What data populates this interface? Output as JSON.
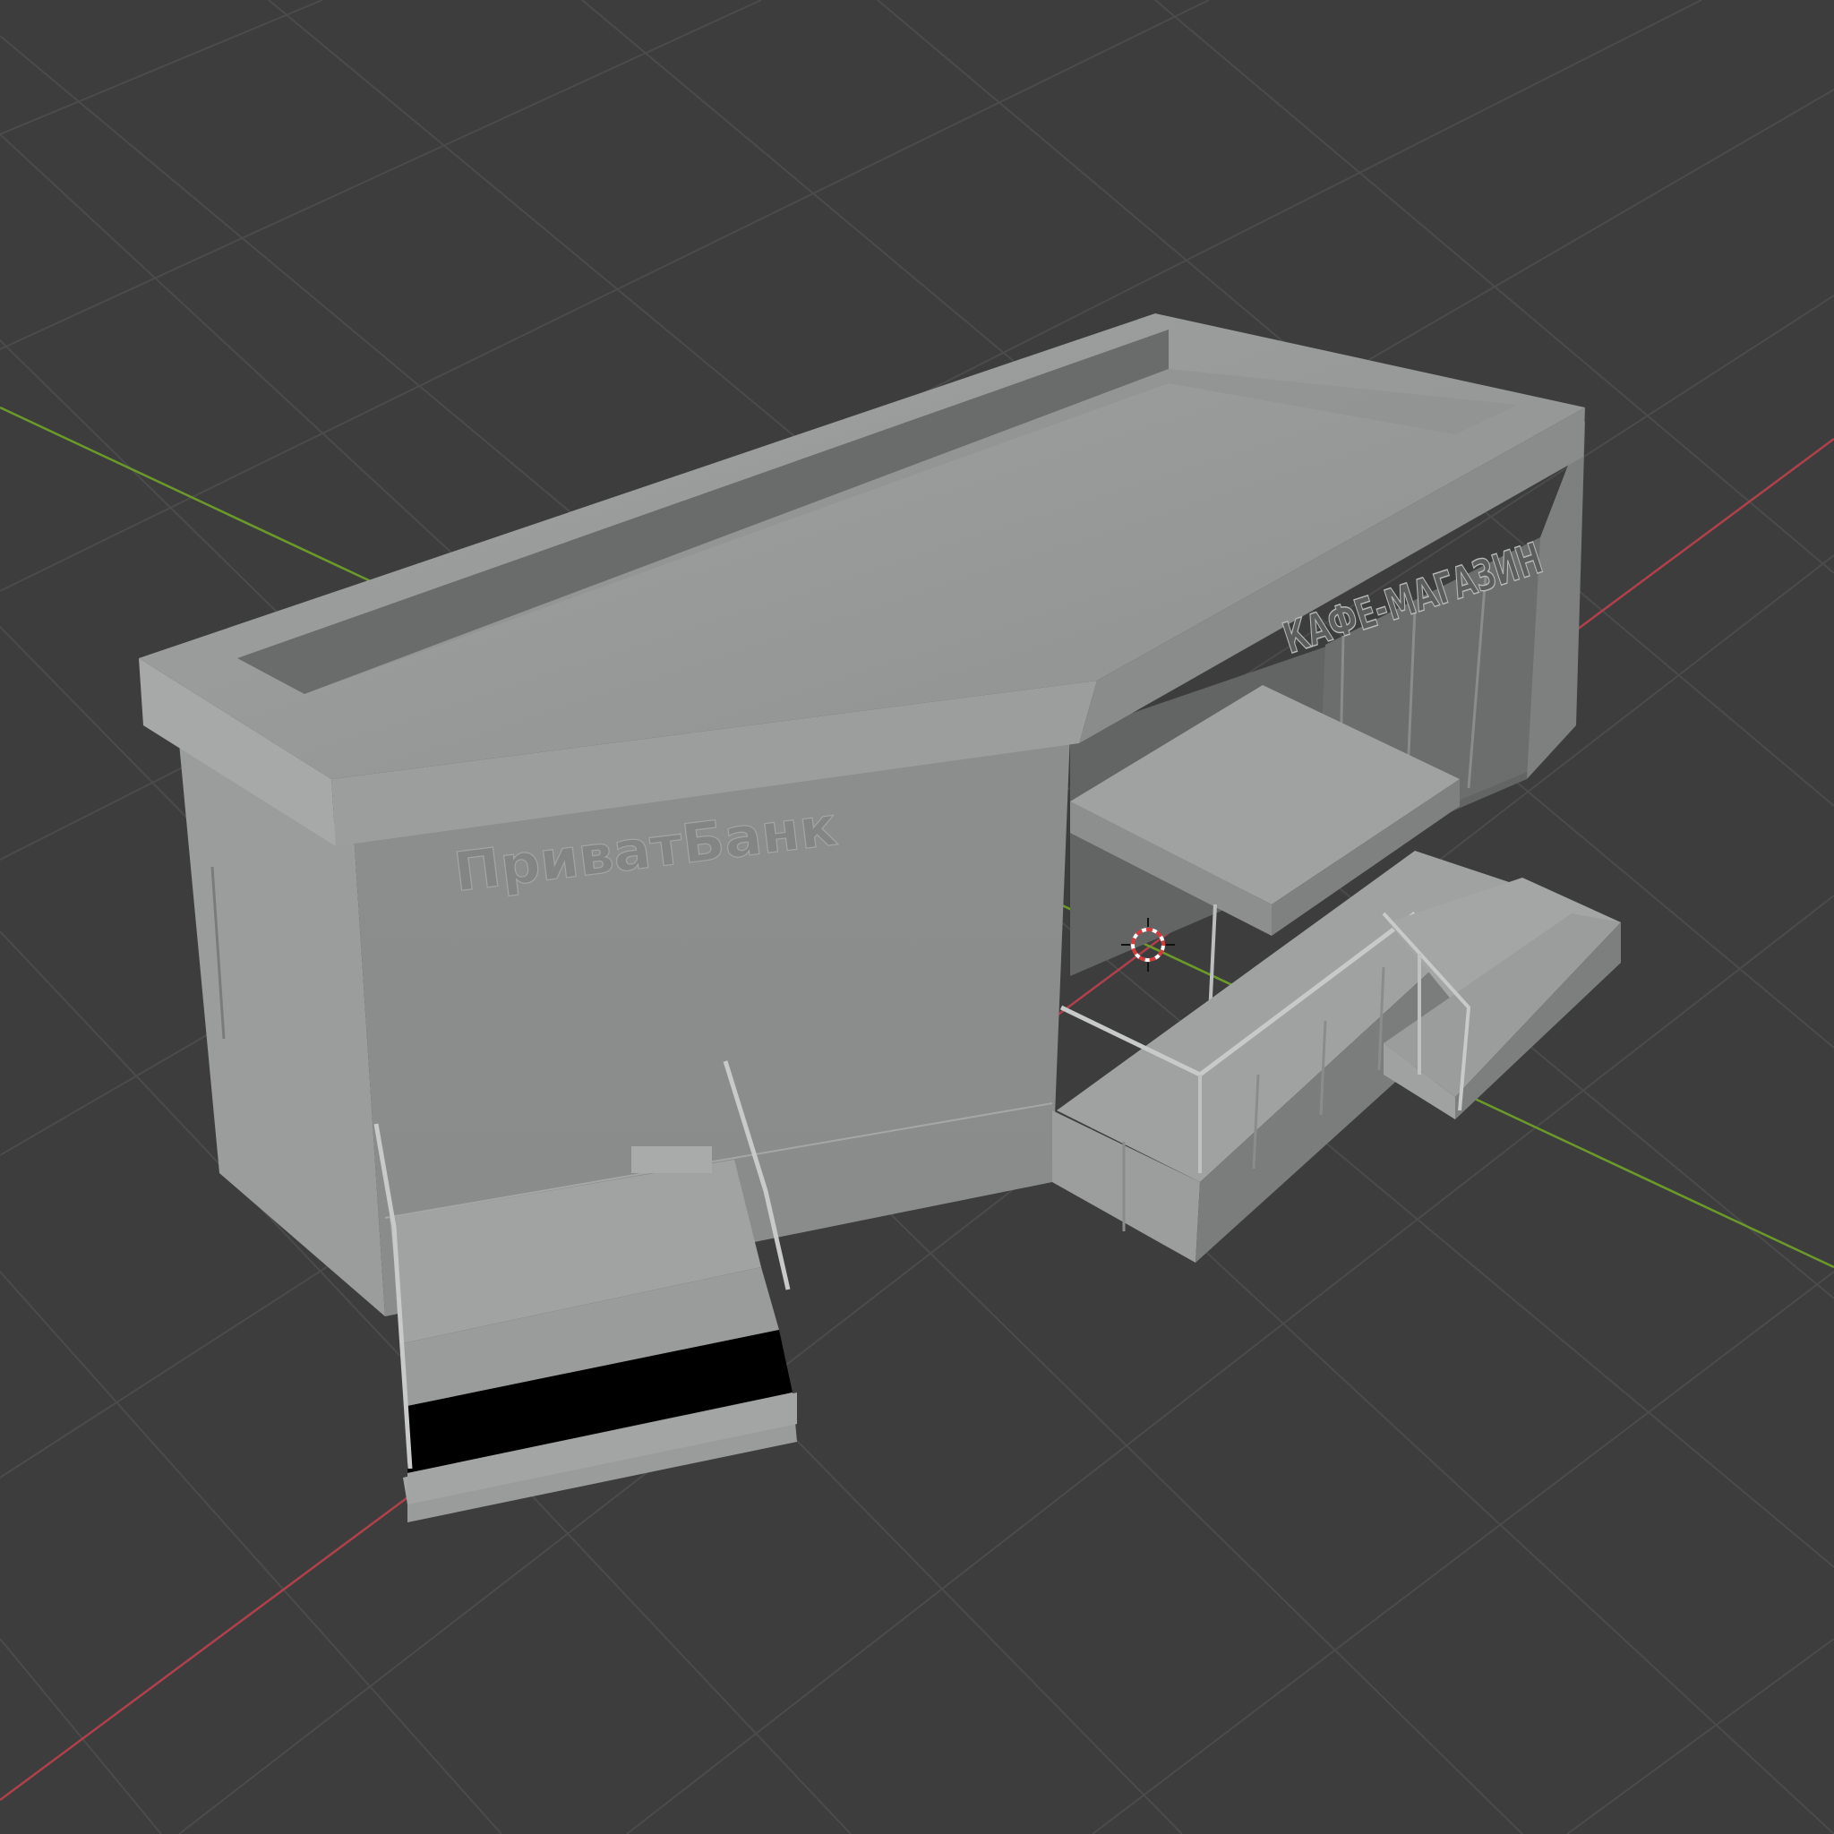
{
  "viewport": {
    "background": "#3d3d3d",
    "grid_color": "#4b4b4b",
    "x_axis_color": "#b0404c",
    "y_axis_color": "#6b9a2a",
    "model": {
      "sign_bank": "ПриватБанк",
      "sign_shop": "КАФЕ-МАГАЗИН",
      "base_color": "#9a9c9c"
    },
    "cursor_icon": "3d-cursor-icon"
  }
}
